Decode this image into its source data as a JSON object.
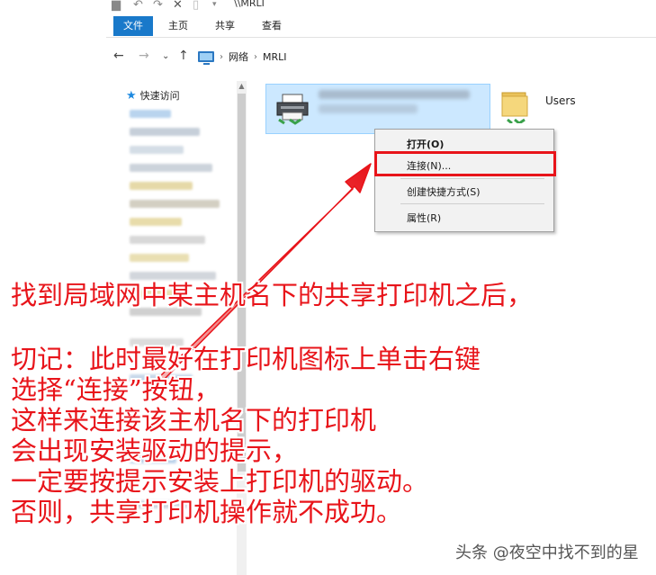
{
  "window": {
    "title": "\\\\MRLI"
  },
  "ribbon": {
    "tabs": [
      "文件",
      "主页",
      "共享",
      "查看"
    ],
    "active": "文件"
  },
  "address": {
    "crumbs": [
      "网络",
      "MRLI"
    ]
  },
  "navpane": {
    "quick_access": "快速访问"
  },
  "content": {
    "items": [
      {
        "label": "Users",
        "icon": "folder-icon"
      }
    ]
  },
  "context_menu": {
    "items": [
      {
        "label": "打开(O)",
        "default": true
      },
      {
        "label": "连接(N)...",
        "highlighted": true
      },
      {
        "label": "创建快捷方式(S)"
      },
      {
        "label": "属性(R)"
      }
    ]
  },
  "annotation": {
    "line1": "找到局域网中某主机名下的共享打印机之后，",
    "line2": "切记：此时最好在打印机图标上单击右键",
    "line3": "选择“连接”按钮，",
    "line4": "这样来连接该主机名下的打印机",
    "line5": "会出现安装驱动的提示，",
    "line6": "一定要按提示安装上打印机的驱动。",
    "line7": "否则，共享打印机操作就不成功。"
  },
  "watermark": "头条 @夜空中找不到的星",
  "colors": {
    "accent": "#1979ca",
    "annotation_red": "#e8141a",
    "selection": "#cce8ff"
  }
}
